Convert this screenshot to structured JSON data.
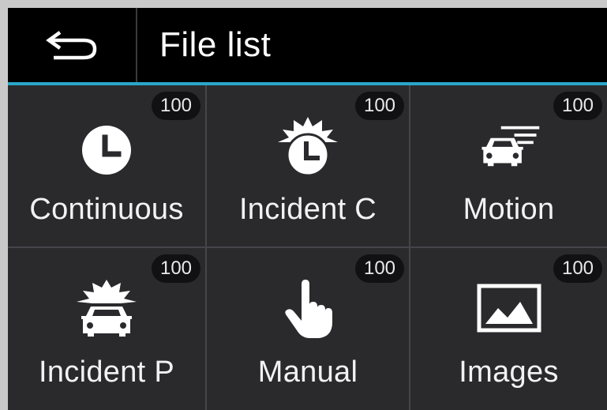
{
  "header": {
    "title": "File list",
    "back_icon": "back-arrow-icon"
  },
  "colors": {
    "accent": "#2aa7c9",
    "header_bg": "#000000",
    "tile_bg": "#2a2a2d",
    "text": "#ffffff"
  },
  "tiles": [
    {
      "label": "Continuous",
      "count": "100",
      "icon": "clock-icon"
    },
    {
      "label": "Incident C",
      "count": "100",
      "icon": "alarm-clock-icon"
    },
    {
      "label": "Motion",
      "count": "100",
      "icon": "car-motion-icon"
    },
    {
      "label": "Incident P",
      "count": "100",
      "icon": "car-impact-icon"
    },
    {
      "label": "Manual",
      "count": "100",
      "icon": "hand-pointer-icon"
    },
    {
      "label": "Images",
      "count": "100",
      "icon": "image-icon"
    }
  ]
}
